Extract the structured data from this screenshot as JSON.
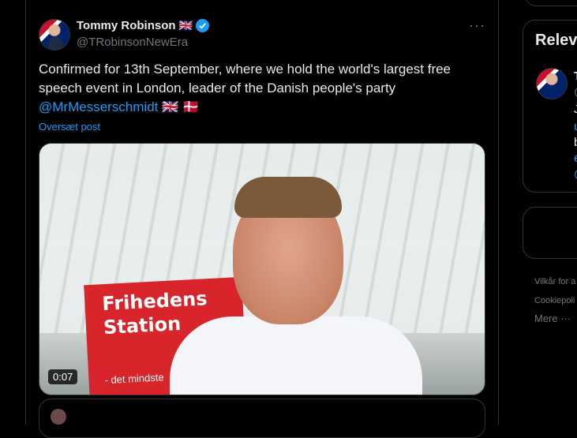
{
  "post": {
    "author_name": "Tommy Robinson",
    "author_flag": "🇬🇧",
    "author_handle": "@TRobinsonNewEra",
    "more_label": "···",
    "text_line1": "Confirmed for 13th September, where we hold the world's largest free",
    "text_line2": "speech event in London, leader of the Danish people's party",
    "mention": "@MrMesserschmidt",
    "flags_after_mention": "🇬🇧 🇩🇰",
    "translate_label": "Oversæt post",
    "video": {
      "duration": "0:07",
      "sign_text_line1": "Frihedens",
      "sign_text_line2": "Station",
      "sign_subtext": "- det mindste"
    }
  },
  "sidebar": {
    "relevant_title": "Relev",
    "relevant_name": "T",
    "relevant_lines": [
      "@",
      "J",
      "u",
      "b",
      "e",
      "@"
    ],
    "footer_links": [
      "Vilkår for a",
      "Cookiepoli"
    ],
    "more_label": "Mere ···"
  },
  "colors": {
    "background": "#000000",
    "accent": "#1d9bf0",
    "text_primary": "#e7e9ea",
    "text_secondary": "#71767b",
    "border": "#2f3336"
  }
}
